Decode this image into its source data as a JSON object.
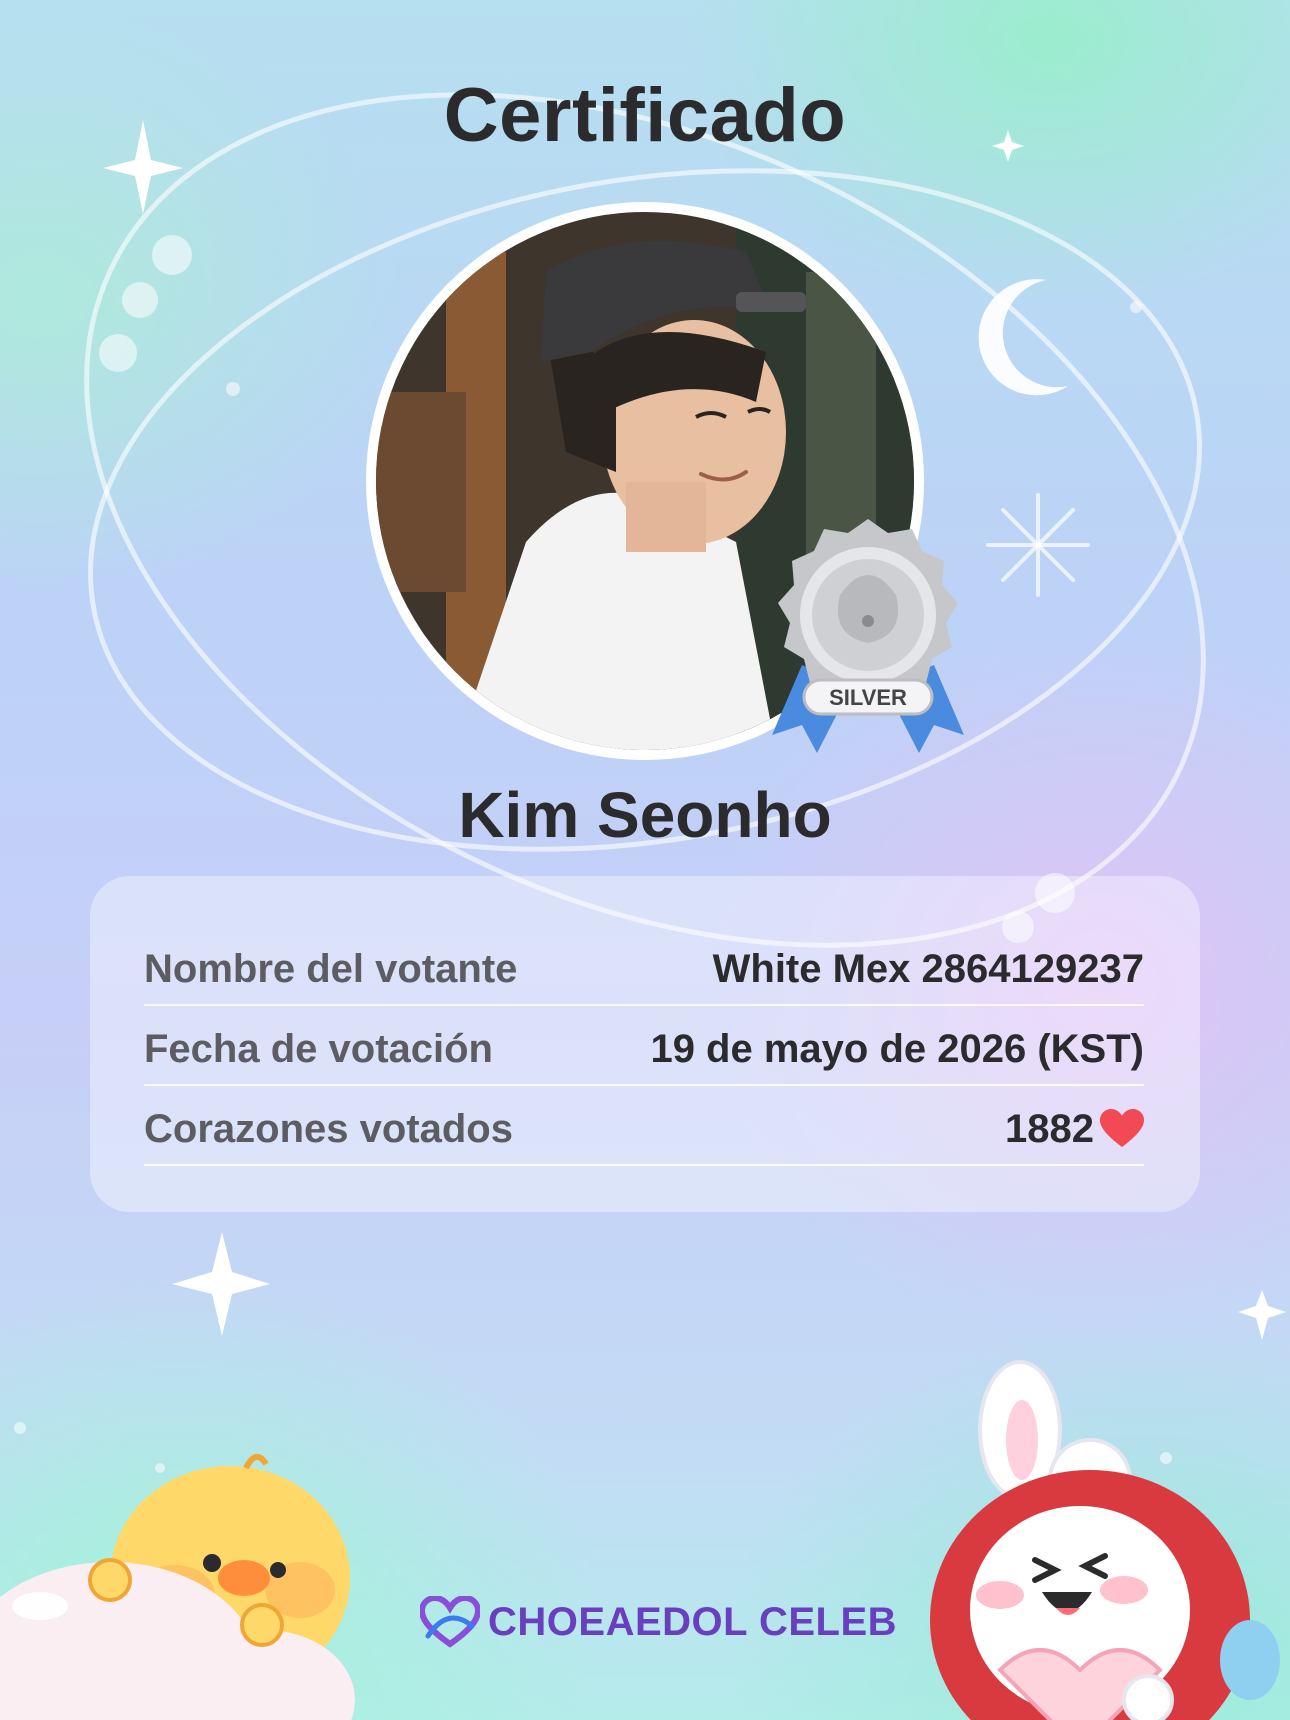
{
  "certificate": {
    "title": "Certificado",
    "celebrity_name": "Kim Seonho",
    "badge_label": "SILVER"
  },
  "details": [
    {
      "label": "Nombre del votante",
      "value": "White Mex 2864129237"
    },
    {
      "label": "Fecha de votación",
      "value": "19 de mayo de 2026 (KST)"
    },
    {
      "label": "Corazones votados",
      "value": "1882"
    }
  ],
  "brand": {
    "name": "CHOEAEDOL CELEB"
  },
  "icons": {
    "heart": "heart-icon",
    "badge": "silver-medal-icon",
    "logo": "choeaedol-logo-icon"
  },
  "colors": {
    "heart": "#f24a55",
    "brand": "#6a3fbf",
    "title_text": "#2b2b2e"
  }
}
